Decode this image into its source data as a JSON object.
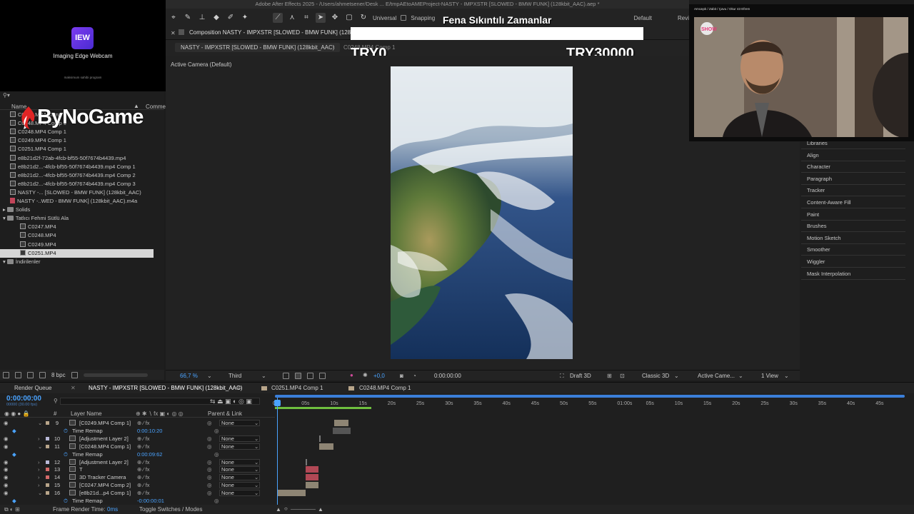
{
  "window": {
    "title": "Adobe After Effects 2025 - /Users/ahmetsener/Desk ... E/tmpAEtoAMEProject-NASTY - IMPXSTR [SLOWED - BMW FUNK] (128kbit_AAC).aep *"
  },
  "toolbar": {
    "universal_label": "Universal",
    "snapping_label": "Snapping",
    "workspace_label": "Default",
    "review_label": "Revi"
  },
  "webcam": {
    "logo_text": "IEW",
    "title": "Imaging Edge Webcam",
    "subtitle": "maksimum sahibi program"
  },
  "donation": {
    "title": "Fena Sıkıntılı Zamanlar",
    "min": "TRY0",
    "max": "TRY30000"
  },
  "brand_overlay": "ByNoGame",
  "camera_overlay": {
    "caption": "Amcaşık / Zabit / Çavu / Okur 43 Efrem",
    "channel": "SHOW"
  },
  "project": {
    "columns": {
      "name": "Name",
      "comment": "Comme"
    },
    "items": [
      {
        "label": "C0247.MP4 Comp 1",
        "type": "comp",
        "indent": 1
      },
      {
        "label": "C0248.MP4 Comp 1",
        "type": "comp",
        "indent": 1
      },
      {
        "label": "C0248.MP4 Comp 1",
        "type": "comp",
        "indent": 1
      },
      {
        "label": "C0249.MP4 Comp 1",
        "type": "comp",
        "indent": 1
      },
      {
        "label": "C0251.MP4 Comp 1",
        "type": "comp",
        "indent": 1
      },
      {
        "label": "e8b21d2f-72ab-4fcb-bf55-50f7674b4439.mp4",
        "type": "comp",
        "indent": 1
      },
      {
        "label": "e8b21d2...-4fcb-bf55-50f7674b4439.mp4 Comp 1",
        "type": "comp",
        "indent": 1
      },
      {
        "label": "e8b21d2...-4fcb-bf55-50f7674b4439.mp4 Comp 2",
        "type": "comp",
        "indent": 1
      },
      {
        "label": "e8b21d2...-4fcb-bf55-50f7674b4439.mp4 Comp 3",
        "type": "comp",
        "indent": 1
      },
      {
        "label": "NASTY -... [SLOWED - BMW FUNK] (128kbit_AAC)",
        "type": "comp",
        "indent": 1
      },
      {
        "label": "NASTY -..WED - BMW FUNK] (128kbit_AAC).m4a",
        "type": "audio",
        "indent": 1
      },
      {
        "label": "Solids",
        "type": "folder",
        "indent": 0
      },
      {
        "label": "Tatlıcı Fehmi Sütlü Ala",
        "type": "folder",
        "indent": 0
      },
      {
        "label": "C0247.MP4",
        "type": "footage",
        "indent": 2
      },
      {
        "label": "C0248.MP4",
        "type": "footage",
        "indent": 2
      },
      {
        "label": "C0249.MP4",
        "type": "footage",
        "indent": 2
      },
      {
        "label": "C0251.MP4",
        "type": "footage",
        "indent": 2,
        "selected": true
      },
      {
        "label": "İndirilenler",
        "type": "folder",
        "indent": 0
      }
    ],
    "bpc": "8 bpc"
  },
  "composition": {
    "panel_title": "Composition NASTY - IMPXSTR [SLOWED - BMW FUNK] (128",
    "active_tab": "NASTY - IMPXSTR [SLOWED - BMW FUNK] (128kbit_AAC)",
    "other_tab": "C0248.MP4 Comp 1",
    "active_camera": "Active Camera (Default)",
    "zoom": "66,7 %",
    "resolution": "Third",
    "exposure": "+0,0",
    "time": "0:00:00:00",
    "draft3d": "Draft 3D",
    "renderer": "Classic 3D",
    "camera_select": "Active Came...",
    "views": "1 View"
  },
  "right_panel": {
    "items": [
      "Libraries",
      "Align",
      "Character",
      "Paragraph",
      "Tracker",
      "Content-Aware Fill",
      "Paint",
      "Brushes",
      "Motion Sketch",
      "Smoother",
      "Wiggler",
      "Mask Interpolation"
    ]
  },
  "timeline": {
    "tabs": [
      "Render Queue",
      "NASTY - IMPXSTR [SLOWED - BMW FUNK] (128kbit_AAC)",
      "C0251.MP4 Comp 1",
      "C0248.MP4 Comp 1"
    ],
    "timecode": "0:00:00:00",
    "fps": "00000 (30.00 fps)",
    "columns": {
      "num": "#",
      "layer_name": "Layer Name",
      "parent": "Parent & Link"
    },
    "ruler": [
      "00s",
      "05s",
      "10s",
      "15s",
      "20s",
      "25s",
      "30s",
      "35s",
      "40s",
      "45s",
      "50s",
      "55s",
      "01:00s",
      "05s",
      "10s",
      "15s",
      "20s",
      "25s",
      "30s",
      "35s",
      "40s",
      "45s"
    ],
    "layers": [
      {
        "num": "9",
        "name": "[C0249.MP4 Comp 1]",
        "color": "#b8a58a",
        "parent": "None",
        "kind": "layer"
      },
      {
        "num": "",
        "name": "Time Remap",
        "value": "0:00:10:20",
        "kind": "prop"
      },
      {
        "num": "10",
        "name": "[Adjustment Layer 2]",
        "color": "#b9b9d8",
        "parent": "None",
        "kind": "layer"
      },
      {
        "num": "11",
        "name": "[C0248.MP4 Comp 1]",
        "color": "#b8a58a",
        "parent": "None",
        "kind": "layer"
      },
      {
        "num": "",
        "name": "Time Remap",
        "value": "0:00:09:62",
        "kind": "prop"
      },
      {
        "num": "12",
        "name": "[Adjustment Layer 2]",
        "color": "#b9b9d8",
        "parent": "None",
        "kind": "layer"
      },
      {
        "num": "13",
        "name": "T",
        "color": "#d46a6a",
        "parent": "None",
        "kind": "layer"
      },
      {
        "num": "14",
        "name": "3D Tracker Camera",
        "color": "#d46a6a",
        "parent": "None",
        "kind": "layer"
      },
      {
        "num": "15",
        "name": "[C0247.MP4 Comp 2]",
        "color": "#b8a58a",
        "parent": "None",
        "kind": "layer"
      },
      {
        "num": "16",
        "name": "[e8b21d...p4 Comp 1]",
        "color": "#b8a58a",
        "parent": "None",
        "kind": "layer"
      },
      {
        "num": "",
        "name": "Time Remap",
        "value": "-0:00:00:01",
        "kind": "prop"
      }
    ],
    "frame_render_label": "Frame Render Time:",
    "frame_render_value": "0ms",
    "toggle_label": "Toggle Switches / Modes"
  }
}
